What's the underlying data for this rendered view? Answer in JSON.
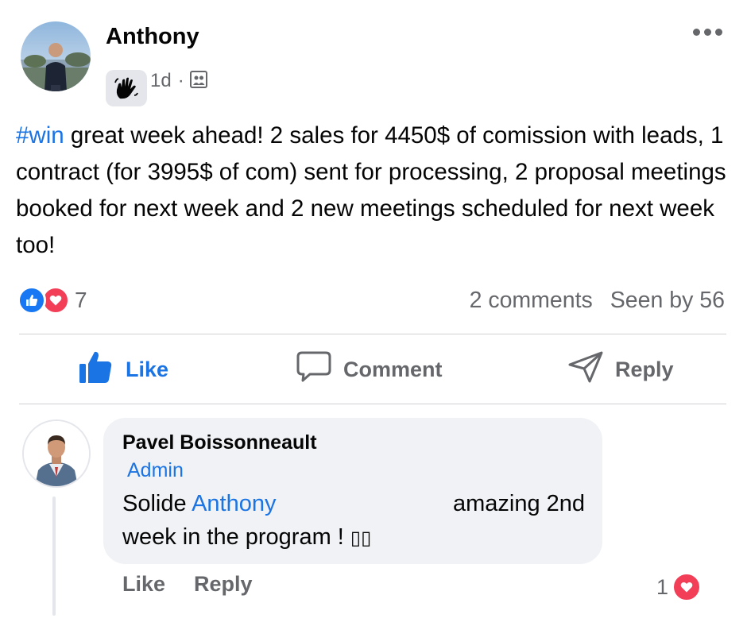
{
  "post": {
    "author": "Anthony",
    "time": "1d",
    "separator": "·",
    "badge_icon": "waving-hand-icon",
    "audience_icon": "group-audience-icon",
    "more_icon": "more-options-icon",
    "hashtag": "#win",
    "text": " great week ahead! 2 sales for 4450$ of comission with leads, 1 contract (for 3995$ of com) sent for processing, 2 proposal meetings booked for next week and 2 new meetings scheduled for next week too!"
  },
  "reactions": {
    "icons": [
      "like-reaction-icon",
      "love-reaction-icon"
    ],
    "count": "7",
    "comments": "2 comments",
    "seen": "Seen by 56"
  },
  "actions": {
    "like": "Like",
    "comment": "Comment",
    "reply": "Reply"
  },
  "comment": {
    "author": "Pavel Boissonneault",
    "badge": "Admin",
    "text_before": "Solide ",
    "mention": "Anthony",
    "text_after": "amazing 2nd",
    "text_line2": "week in the program ! ",
    "emoji_placeholder": "▯▯",
    "like": "Like",
    "reply": "Reply",
    "reaction_count": "1",
    "reaction_icon": "love-reaction-icon"
  },
  "colors": {
    "accent": "#1b74e4",
    "secondary_text": "#65676b",
    "love": "#f33e58",
    "bubble": "#f0f2f5"
  }
}
